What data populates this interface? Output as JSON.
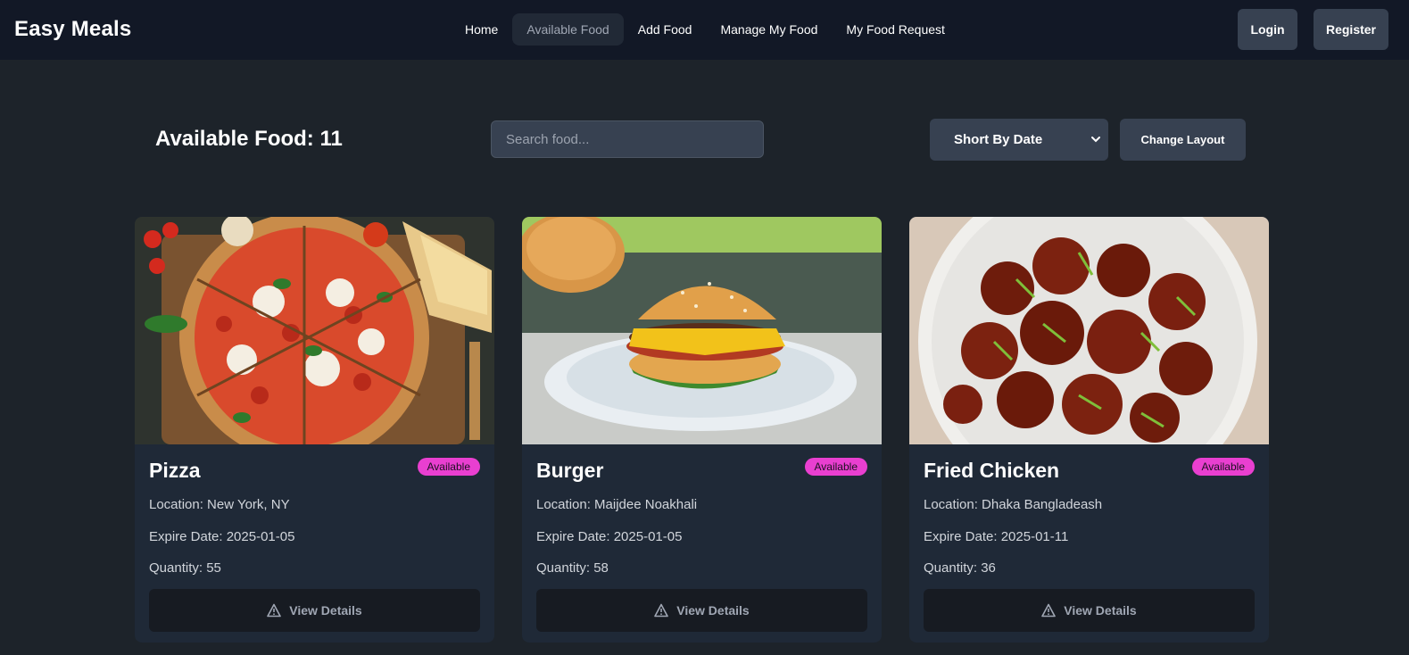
{
  "navbar": {
    "brand": "Easy Meals",
    "links": [
      {
        "label": "Home",
        "active": false
      },
      {
        "label": "Available Food",
        "active": true
      },
      {
        "label": "Add Food",
        "active": false
      },
      {
        "label": "Manage My Food",
        "active": false
      },
      {
        "label": "My Food Request",
        "active": false
      }
    ],
    "login_label": "Login",
    "register_label": "Register"
  },
  "toolbar": {
    "title": "Available Food: 11",
    "search_placeholder": "Search food...",
    "sort_selected": "Short By Date",
    "change_layout_label": "Change Layout"
  },
  "foods": [
    {
      "name": "Pizza",
      "status": "Available",
      "location": "Location: New York, NY",
      "expire": "Expire Date: 2025-01-05",
      "quantity": "Quantity: 55",
      "button": "View Details",
      "image": "pizza-photo"
    },
    {
      "name": "Burger",
      "status": "Available",
      "location": "Location: Maijdee Noakhali",
      "expire": "Expire Date: 2025-01-05",
      "quantity": "Quantity: 58",
      "button": "View Details",
      "image": "burger-photo"
    },
    {
      "name": "Fried Chicken",
      "status": "Available",
      "location": "Location: Dhaka Bangladeash",
      "expire": "Expire Date: 2025-01-11",
      "quantity": "Quantity: 36",
      "button": "View Details",
      "image": "fried-chicken-photo"
    }
  ],
  "colors": {
    "navbar_bg": "#121826",
    "page_bg": "#1d232a",
    "card_bg": "#1f2937",
    "badge": "#e93fd0",
    "button_bg": "#374151"
  }
}
